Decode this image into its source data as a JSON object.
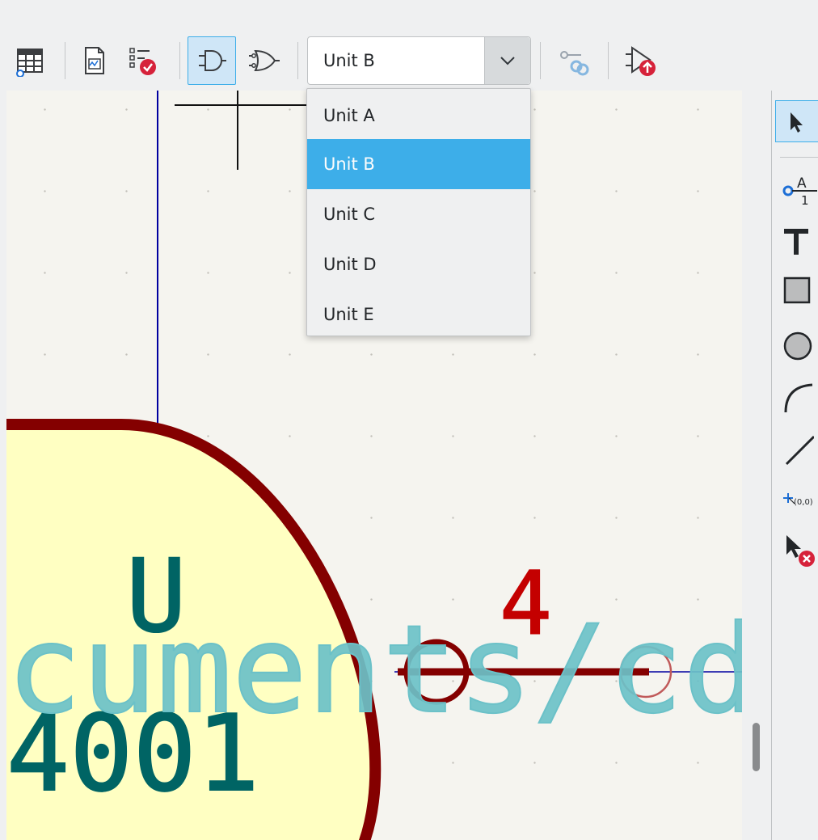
{
  "toolbar": {
    "unit_selector": {
      "selected": "Unit B",
      "options": [
        "Unit A",
        "Unit B",
        "Unit C",
        "Unit D",
        "Unit E"
      ],
      "expanded": true
    },
    "active_tool": "de-morgan-standard"
  },
  "canvas": {
    "reference_text": "U",
    "value_text": "4001",
    "pin_number": "4",
    "overlay_text": "cuments/cd",
    "colors": {
      "background": "#f5f4ef",
      "body_fill": "#ffffc2",
      "outline": "#840000",
      "field_text": "#006464",
      "overlay_text": "#6bc1c8",
      "wire": "#0000a0"
    }
  },
  "right_toolbar": {
    "items": [
      "select-arrow-icon",
      "pin-icon",
      "text-icon",
      "rectangle-icon",
      "circle-icon",
      "arc-icon",
      "line-icon",
      "anchor-icon",
      "delete-tool-icon"
    ],
    "anchor_label": "(0,0)",
    "pin_label_top": "A",
    "pin_label_bottom": "1"
  },
  "accent_color": "#3daee9"
}
